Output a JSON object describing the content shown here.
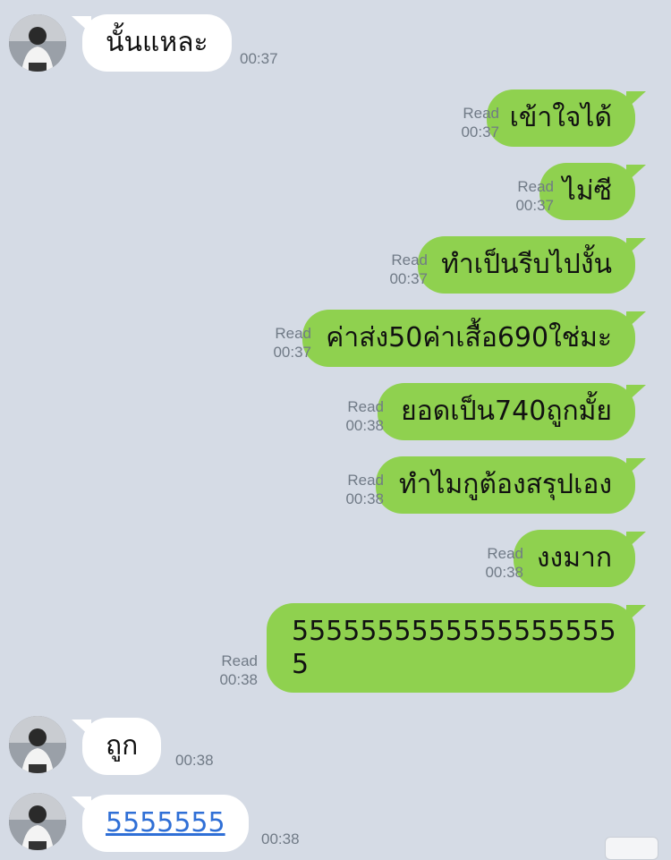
{
  "colors": {
    "background": "#d5dbe5",
    "outgoing_bubble": "#8fd14f",
    "incoming_bubble": "#ffffff",
    "meta_text": "#707a86",
    "link": "#2f6fd6"
  },
  "messages": [
    {
      "direction": "in",
      "text": "นั้นแหละ",
      "time": "00:37"
    },
    {
      "direction": "out",
      "text": "เข้าใจได้",
      "status": "Read",
      "time": "00:37"
    },
    {
      "direction": "out",
      "text": "ไม่ซี",
      "status": "Read",
      "time": "00:37"
    },
    {
      "direction": "out",
      "text": "ทำเป็นรีบไปงั้น",
      "status": "Read",
      "time": "00:37"
    },
    {
      "direction": "out",
      "text": "ค่าส่ง50ค่าเสื้อ690ใช่มะ",
      "status": "Read",
      "time": "00:37"
    },
    {
      "direction": "out",
      "text": "ยอดเป็น740ถูกมั้ย",
      "status": "Read",
      "time": "00:38"
    },
    {
      "direction": "out",
      "text": "ทำไมกูต้องสรุปเอง",
      "status": "Read",
      "time": "00:38"
    },
    {
      "direction": "out",
      "text": "งงมาก",
      "status": "Read",
      "time": "00:38"
    },
    {
      "direction": "out",
      "text_line1": "5555555555555555555",
      "text_line2": "5",
      "status": "Read",
      "time": "00:38"
    },
    {
      "direction": "in",
      "text": "ถูก",
      "time": "00:38"
    },
    {
      "direction": "in",
      "text": "5555555",
      "time": "00:38",
      "is_link": true
    }
  ]
}
